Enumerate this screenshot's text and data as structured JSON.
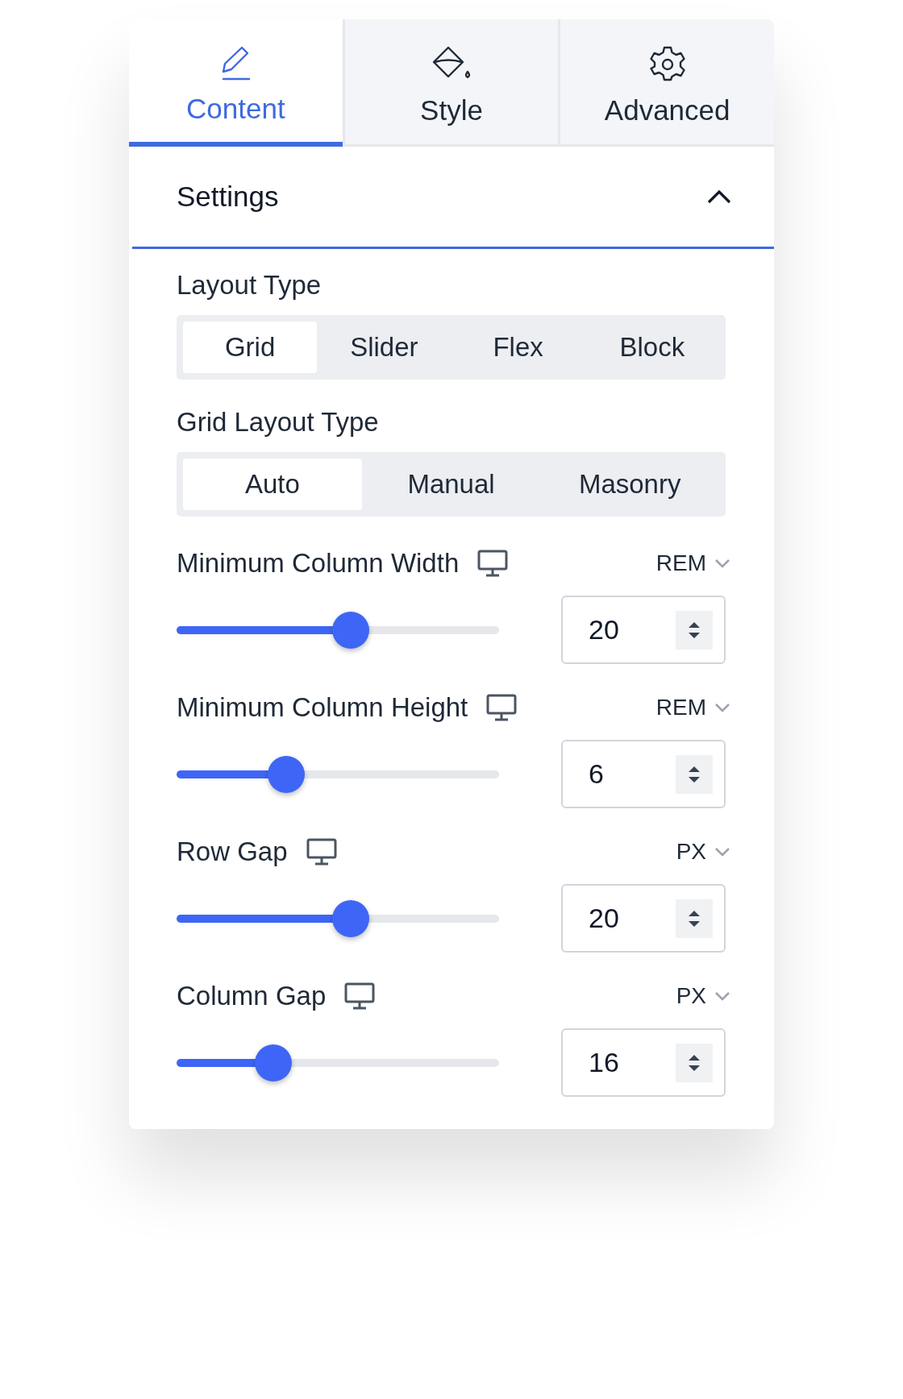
{
  "tabs": [
    {
      "label": "Content",
      "selected": true
    },
    {
      "label": "Style",
      "selected": false
    },
    {
      "label": "Advanced",
      "selected": false
    }
  ],
  "section": {
    "title": "Settings",
    "expanded": true
  },
  "segments": [
    {
      "label": "Layout Type",
      "options": [
        {
          "label": "Grid",
          "selected": true
        },
        {
          "label": "Slider",
          "selected": false
        },
        {
          "label": "Flex",
          "selected": false
        },
        {
          "label": "Block",
          "selected": false
        }
      ]
    },
    {
      "label": "Grid Layout Type",
      "options": [
        {
          "label": "Auto",
          "selected": true
        },
        {
          "label": "Manual",
          "selected": false
        },
        {
          "label": "Masonry",
          "selected": false
        }
      ]
    }
  ],
  "sliders": [
    {
      "label": "Minimum Column Width",
      "unit": "REM",
      "level": 0.54,
      "value": "20"
    },
    {
      "label": "Minimum Column Height",
      "unit": "REM",
      "level": 0.34,
      "value": "6"
    },
    {
      "label": "Row Gap",
      "unit": "PX",
      "level": 0.54,
      "value": "20"
    },
    {
      "label": "Column Gap",
      "unit": "PX",
      "level": 0.3,
      "value": "16"
    }
  ]
}
